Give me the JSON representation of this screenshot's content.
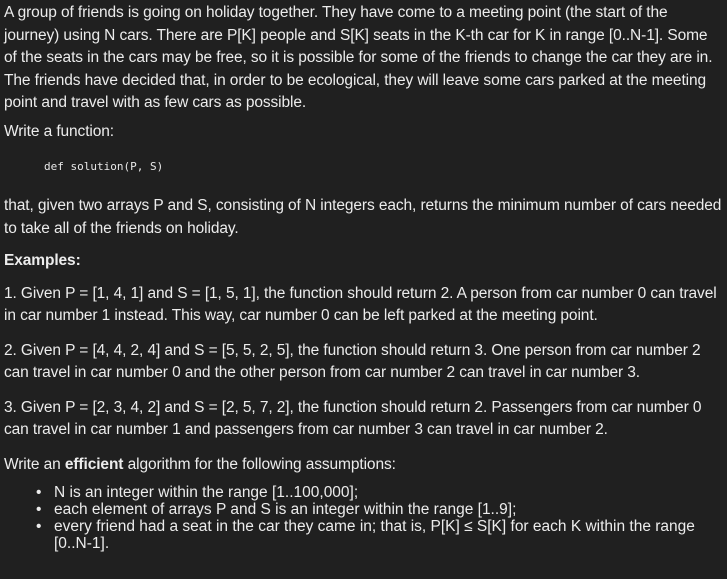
{
  "intro": "A group of friends is going on holiday together. They have come to a meeting point (the start of the journey) using N cars. There are P[K] people and S[K] seats in the K-th car for K in range [0..N-1]. Some of the seats in the cars may be free, so it is possible for some of the friends to change the car they are in. The friends have decided that, in order to be ecological, they will leave some cars parked at the meeting point and travel with as few cars as possible.",
  "write_function": "Write a function:",
  "code": "def solution(P, S)",
  "given": "that, given two arrays P and S, consisting of N integers each, returns the minimum number of cars needed to take all of the friends on holiday.",
  "examples_heading": "Examples:",
  "examples": [
    "1. Given P = [1, 4, 1] and S = [1, 5, 1], the function should return 2. A person from car number 0 can travel in car number 1 instead. This way, car number 0 can be left parked at the meeting point.",
    "2. Given P = [4, 4, 2, 4] and S = [5, 5, 2, 5], the function should return 3. One person from car number 2 can travel in car number 0 and the other person from car number 2 can travel in car number 3.",
    "3. Given P = [2, 3, 4, 2] and S = [2, 5, 7, 2], the function should return 2. Passengers from car number 0 can travel in car number 1 and passengers from car number 3 can travel in car number 2."
  ],
  "assumptions": {
    "prefix": "Write an ",
    "emphasis": "efficient",
    "suffix": " algorithm for the following assumptions:",
    "bullet_glyph": "•",
    "items": [
      "N is an integer within the range [1..100,000];",
      "each element of arrays P and S is an integer within the range [1..9];",
      "every friend had a seat in the car they came in; that is, P[K] ≤ S[K] for each K within the range [0..N-1]."
    ]
  }
}
